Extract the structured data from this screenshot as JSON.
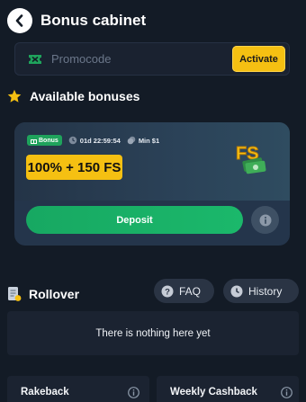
{
  "header": {
    "title": "Bonus cabinet",
    "back_icon": "chevron-left-icon"
  },
  "promo": {
    "placeholder": "Promocode",
    "activate_label": "Activate",
    "icon": "ticket-icon"
  },
  "available": {
    "title": "Available bonuses",
    "icon": "star-icon",
    "card": {
      "tag_label": "Bonus",
      "timer": "01d 22:59:54",
      "min_deposit": "Min $1",
      "amount": "100% + 150 FS",
      "badge_text": "FS",
      "deposit_label": "Deposit"
    }
  },
  "rollover": {
    "title": "Rollover",
    "faq_label": "FAQ",
    "history_label": "History",
    "empty_text": "There is nothing here yet"
  },
  "cashback": {
    "rakeback_label": "Rakeback",
    "weekly_label": "Weekly Cashback"
  },
  "colors": {
    "background": "#131b26",
    "accent_yellow": "#f5c012",
    "accent_green": "#1bb86b"
  }
}
